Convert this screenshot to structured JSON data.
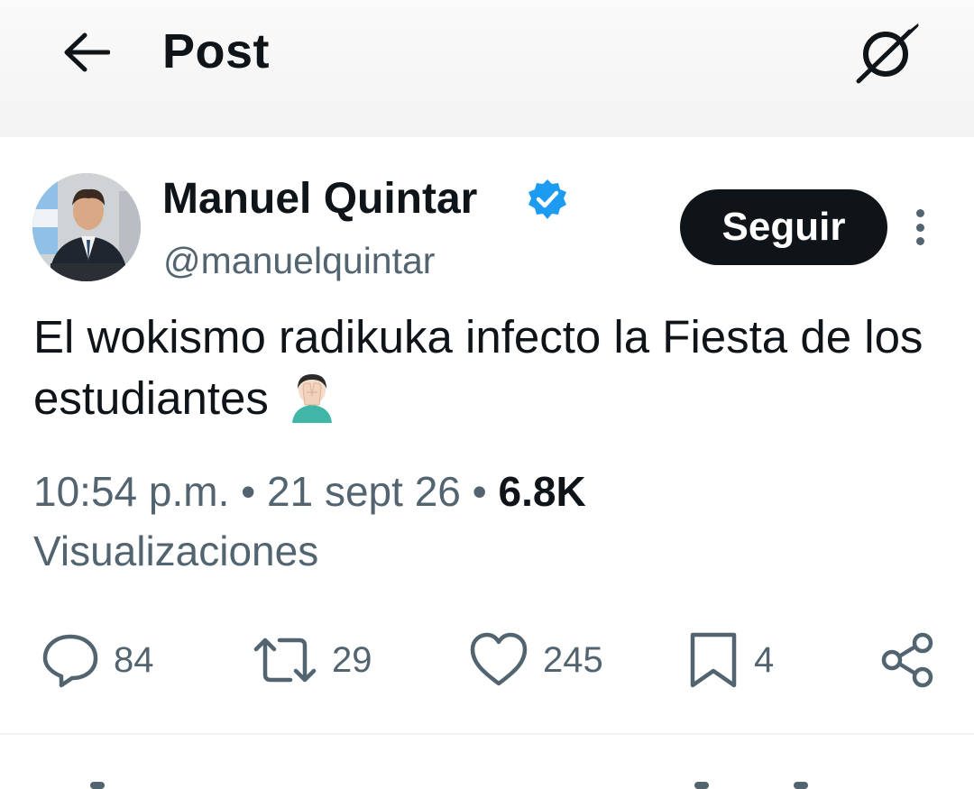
{
  "header": {
    "title": "Post",
    "back_icon": "arrow-left-icon",
    "grok_icon": "grok-icon"
  },
  "post": {
    "author": {
      "name": "Manuel Quintar",
      "handle": "@manuelquintar",
      "verified": true,
      "verified_color": "#1d9bf0"
    },
    "follow_label": "Seguir",
    "text": "El wokismo radikuka infecto la Fiesta de los estudiantes",
    "text_emoji": "man-facepalming-emoji",
    "time": "10:54 p.m.",
    "date": "21 sept 26",
    "separator": "•",
    "views_count": "6.8K",
    "views_label": "Visualizaciones"
  },
  "actions": {
    "replies": "84",
    "reposts": "29",
    "likes": "245",
    "bookmarks": "4"
  },
  "colors": {
    "text_primary": "#0f1419",
    "text_secondary": "#536471",
    "button_bg": "#0f1419",
    "accent_blue": "#1d9bf0"
  }
}
